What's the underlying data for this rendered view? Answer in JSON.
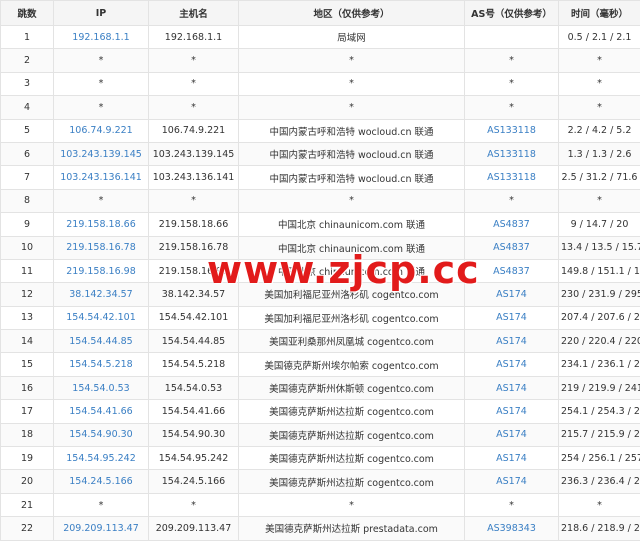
{
  "headers": {
    "hop": "跳数",
    "ip": "IP",
    "hostname": "主机名",
    "region": "地区（仅供参考）",
    "as": "AS号（仅供参考）",
    "time": "时间（毫秒）"
  },
  "rows": [
    {
      "hop": "1",
      "ip": "192.168.1.1",
      "hostname": "192.168.1.1",
      "region": "局域网",
      "as": "",
      "time": "0.5 / 2.1 / 2.1"
    },
    {
      "hop": "2",
      "ip": "*",
      "hostname": "*",
      "region": "*",
      "as": "*",
      "time": "*"
    },
    {
      "hop": "3",
      "ip": "*",
      "hostname": "*",
      "region": "*",
      "as": "*",
      "time": "*"
    },
    {
      "hop": "4",
      "ip": "*",
      "hostname": "*",
      "region": "*",
      "as": "*",
      "time": "*"
    },
    {
      "hop": "5",
      "ip": "106.74.9.221",
      "hostname": "106.74.9.221",
      "region": "中国内蒙古呼和浩特 wocloud.cn 联通",
      "as": "AS133118",
      "time": "2.2 / 4.2 / 5.2"
    },
    {
      "hop": "6",
      "ip": "103.243.139.145",
      "hostname": "103.243.139.145",
      "region": "中国内蒙古呼和浩特 wocloud.cn 联通",
      "as": "AS133118",
      "time": "1.3 / 1.3 / 2.6"
    },
    {
      "hop": "7",
      "ip": "103.243.136.141",
      "hostname": "103.243.136.141",
      "region": "中国内蒙古呼和浩特 wocloud.cn 联通",
      "as": "AS133118",
      "time": "2.5 / 31.2 / 71.6"
    },
    {
      "hop": "8",
      "ip": "*",
      "hostname": "*",
      "region": "*",
      "as": "*",
      "time": "*"
    },
    {
      "hop": "9",
      "ip": "219.158.18.66",
      "hostname": "219.158.18.66",
      "region": "中国北京 chinaunicom.com 联通",
      "as": "AS4837",
      "time": "9 / 14.7 / 20"
    },
    {
      "hop": "10",
      "ip": "219.158.16.78",
      "hostname": "219.158.16.78",
      "region": "中国北京 chinaunicom.com 联通",
      "as": "AS4837",
      "time": "13.4 / 13.5 / 15.7"
    },
    {
      "hop": "11",
      "ip": "219.158.16.98",
      "hostname": "219.158.16.98",
      "region": "中国北京 chinaunicom.com 联通",
      "as": "AS4837",
      "time": "149.8 / 151.1 / 152.5"
    },
    {
      "hop": "12",
      "ip": "38.142.34.57",
      "hostname": "38.142.34.57",
      "region": "美国加利福尼亚州洛杉矶 cogentco.com",
      "as": "AS174",
      "time": "230 / 231.9 / 295.9"
    },
    {
      "hop": "13",
      "ip": "154.54.42.101",
      "hostname": "154.54.42.101",
      "region": "美国加利福尼亚州洛杉矶 cogentco.com",
      "as": "AS174",
      "time": "207.4 / 207.6 / 217.6"
    },
    {
      "hop": "14",
      "ip": "154.54.44.85",
      "hostname": "154.54.44.85",
      "region": "美国亚利桑那州凤凰城 cogentco.com",
      "as": "AS174",
      "time": "220 / 220.4 / 220.5"
    },
    {
      "hop": "15",
      "ip": "154.54.5.218",
      "hostname": "154.54.5.218",
      "region": "美国德克萨斯州埃尔帕索 cogentco.com",
      "as": "AS174",
      "time": "234.1 / 236.1 / 236.7"
    },
    {
      "hop": "16",
      "ip": "154.54.0.53",
      "hostname": "154.54.0.53",
      "region": "美国德克萨斯州休斯顿 cogentco.com",
      "as": "AS174",
      "time": "219 / 219.9 / 241.5"
    },
    {
      "hop": "17",
      "ip": "154.54.41.66",
      "hostname": "154.54.41.66",
      "region": "美国德克萨斯州达拉斯 cogentco.com",
      "as": "AS174",
      "time": "254.1 / 254.3 / 257"
    },
    {
      "hop": "18",
      "ip": "154.54.90.30",
      "hostname": "154.54.90.30",
      "region": "美国德克萨斯州达拉斯 cogentco.com",
      "as": "AS174",
      "time": "215.7 / 215.9 / 216.9"
    },
    {
      "hop": "19",
      "ip": "154.54.95.242",
      "hostname": "154.54.95.242",
      "region": "美国德克萨斯州达拉斯 cogentco.com",
      "as": "AS174",
      "time": "254 / 256.1 / 257.3"
    },
    {
      "hop": "20",
      "ip": "154.24.5.166",
      "hostname": "154.24.5.166",
      "region": "美国德克萨斯州达拉斯 cogentco.com",
      "as": "AS174",
      "time": "236.3 / 236.4 / 239.9"
    },
    {
      "hop": "21",
      "ip": "*",
      "hostname": "*",
      "region": "*",
      "as": "*",
      "time": "*"
    },
    {
      "hop": "22",
      "ip": "209.209.113.47",
      "hostname": "209.209.113.47",
      "region": "美国德克萨斯州达拉斯 prestadata.com",
      "as": "AS398343",
      "time": "218.6 / 218.9 / 250.4"
    }
  ],
  "watermark": "www.zjcp.cc",
  "colors": {
    "link": "#3a7fc4",
    "watermark": "#e21b1b",
    "header_bg": "#f5f5f5",
    "border": "#e3e3e3"
  }
}
